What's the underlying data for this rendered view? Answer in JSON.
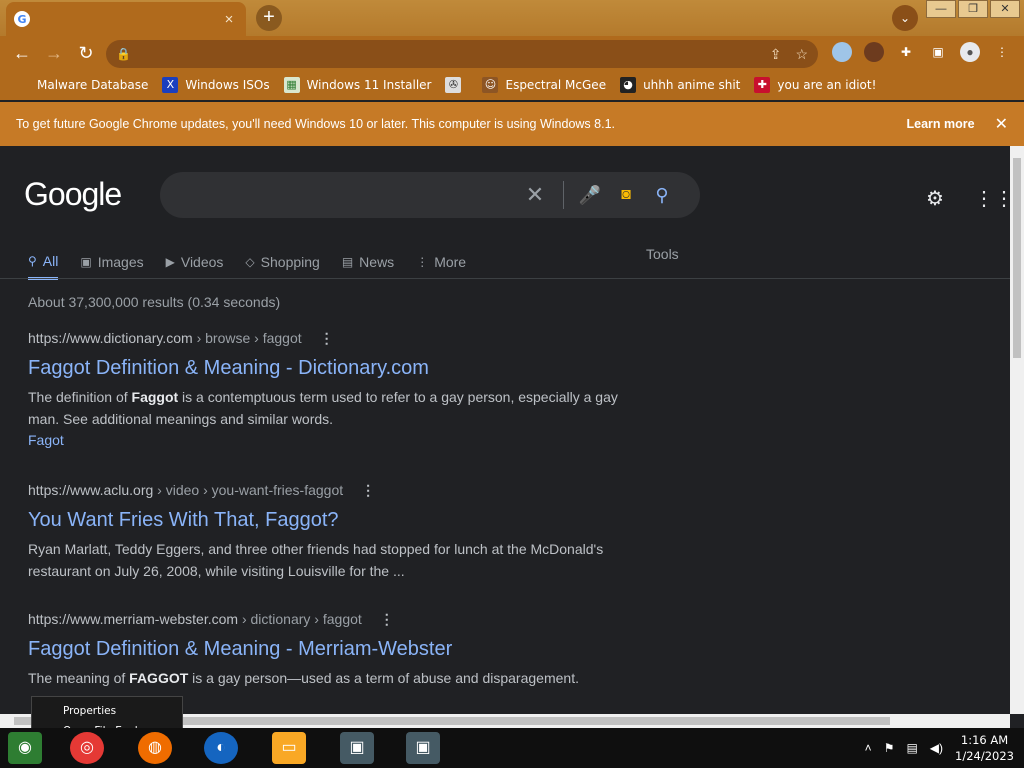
{
  "browser": {
    "tab_title": "",
    "tab_close": "×",
    "new_tab": "+",
    "tab_search": "⌄",
    "window_buttons": [
      "—",
      "❐",
      "✕"
    ],
    "url": "",
    "info_bar": {
      "message": "To get future Google Chrome updates, you'll need Windows 10 or later. This computer is using Windows 8.1.",
      "learn_more": "Learn more",
      "close": "✕"
    },
    "bookmarks": [
      {
        "label": "Malware Database",
        "icon": "bookmark-icon"
      },
      {
        "label": "Windows ISOs",
        "icon": "x-logo-icon"
      },
      {
        "label": "Windows 11 Installer",
        "icon": "image-icon"
      },
      {
        "label": "",
        "icon": "film-icon"
      },
      {
        "label": "Espectral McGee",
        "icon": "avatar-icon"
      },
      {
        "label": "uhhh anime shit",
        "icon": "anime-icon"
      },
      {
        "label": "you are an idiot!",
        "icon": "flag-icon"
      }
    ]
  },
  "google": {
    "logo": "Google",
    "query": "",
    "tabs": [
      {
        "label": "All",
        "icon": "search-icon",
        "active": true
      },
      {
        "label": "Images",
        "icon": "image-icon",
        "active": false
      },
      {
        "label": "Videos",
        "icon": "play-icon",
        "active": false
      },
      {
        "label": "Shopping",
        "icon": "tag-icon",
        "active": false
      },
      {
        "label": "News",
        "icon": "news-icon",
        "active": false
      },
      {
        "label": "More",
        "icon": "kebab-icon",
        "active": false
      }
    ],
    "tools": "Tools",
    "stats": "About 37,300,000 results (0.34 seconds)",
    "results": [
      {
        "host": "https://www.dictionary.com",
        "path": " › browse › faggot",
        "title": "Faggot Definition & Meaning - Dictionary.com",
        "snippet_pre": "The definition of ",
        "snippet_bold": "Faggot",
        "snippet_post": " is a contemptuous term used to refer to a gay person, especially a gay man. See additional meanings and similar words.",
        "sublink": "Fagot"
      },
      {
        "host": "https://www.aclu.org",
        "path": " › video › you-want-fries-faggot",
        "title": "You Want Fries With That, Faggot?",
        "snippet_pre": "Ryan Marlatt, Teddy Eggers, and three other friends had stopped for lunch at the McDonald's restaurant on July 26, 2008, while visiting Louisville for the ...",
        "snippet_bold": "",
        "snippet_post": "",
        "sublink": ""
      },
      {
        "host": "https://www.merriam-webster.com",
        "path": " › dictionary › faggot",
        "title": "Faggot Definition & Meaning - Merriam-Webster",
        "snippet_pre": "The meaning of ",
        "snippet_bold": "FAGGOT",
        "snippet_post": " is a gay person—used as a term of abuse and disparagement.",
        "sublink": ""
      }
    ]
  },
  "context_menu": {
    "items": [
      "Properties",
      "Open File Explorer"
    ]
  },
  "taskbar": {
    "time": "1:16 AM",
    "date": "1/24/2023"
  }
}
